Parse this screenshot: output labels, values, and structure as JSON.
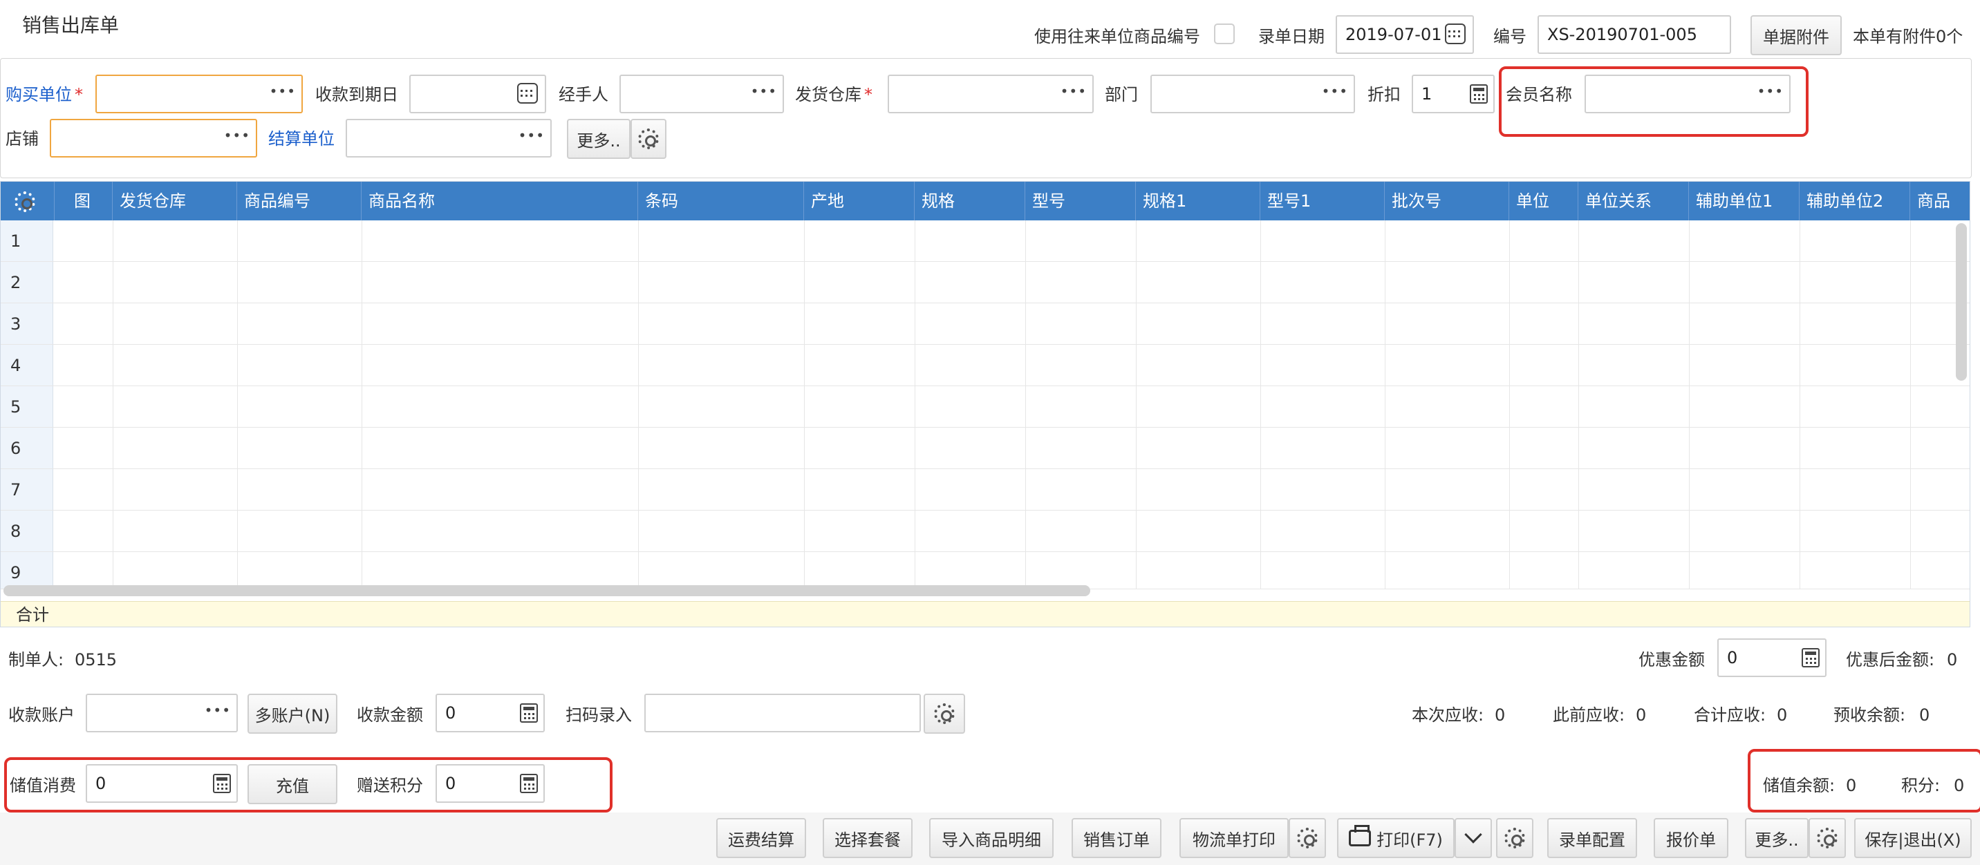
{
  "title": "销售出库单",
  "top": {
    "use_partner_code_label": "使用往来单位商品编号",
    "date_label": "录单日期",
    "date_value": "2019-07-01",
    "number_label": "编号",
    "number_value": "XS-20190701-005",
    "attachment_button": "单据附件",
    "attachment_info": "本单有附件0个"
  },
  "form": {
    "buyer_label": "购买单位",
    "required_mark": "*",
    "due_date_label": "收款到期日",
    "handler_label": "经手人",
    "warehouse_label": "发货仓库",
    "dept_label": "部门",
    "discount_label": "折扣",
    "discount_value": "1",
    "member_label": "会员名称",
    "shop_label": "店铺",
    "settle_label": "结算单位",
    "more_button": "更多..",
    "dots": "•••"
  },
  "grid": {
    "columns": [
      "图",
      "发货仓库",
      "商品编号",
      "商品名称",
      "条码",
      "产地",
      "规格",
      "型号",
      "规格1",
      "型号1",
      "批次号",
      "单位",
      "单位关系",
      "辅助单位1",
      "辅助单位2",
      "商品"
    ],
    "rows": [
      "1",
      "2",
      "3",
      "4",
      "5",
      "6",
      "7",
      "8",
      "9"
    ],
    "total_label": "合计"
  },
  "bottom": {
    "maker_label": "制单人:",
    "maker_value": "0515",
    "discount_amount_label": "优惠金额",
    "discount_amount_value": "0",
    "after_discount_label": "优惠后金额:",
    "after_discount_value": "0",
    "account_label": "收款账户",
    "multi_account_button": "多账户(N)",
    "receipt_amount_label": "收款金额",
    "receipt_amount_value": "0",
    "scan_label": "扫码录入",
    "current_receivable_label": "本次应收:",
    "current_receivable_value": "0",
    "prior_receivable_label": "此前应收:",
    "prior_receivable_value": "0",
    "total_receivable_label": "合计应收:",
    "total_receivable_value": "0",
    "prepaid_balance_label": "预收余额:",
    "prepaid_balance_value": "0",
    "stored_consume_label": "储值消费",
    "stored_consume_value": "0",
    "recharge_button": "充值",
    "gift_points_label": "赠送积分",
    "gift_points_value": "0",
    "stored_balance_label": "储值余额:",
    "stored_balance_value": "0",
    "points_label": "积分:",
    "points_value": "0"
  },
  "footer_buttons": {
    "freight": "运费结算",
    "package": "选择套餐",
    "import": "导入商品明细",
    "sales_order": "销售订单",
    "logistics_print": "物流单打印",
    "print": "打印(F7)",
    "entry_config": "录单配置",
    "quote": "报价单",
    "more": "更多..",
    "save_exit": "保存|退出(X)"
  },
  "colors": {
    "header_blue": "#3c7fc6",
    "label_blue": "#1b5fcc",
    "highlight_red": "#e0302a",
    "required_orange": "#f0a640"
  }
}
